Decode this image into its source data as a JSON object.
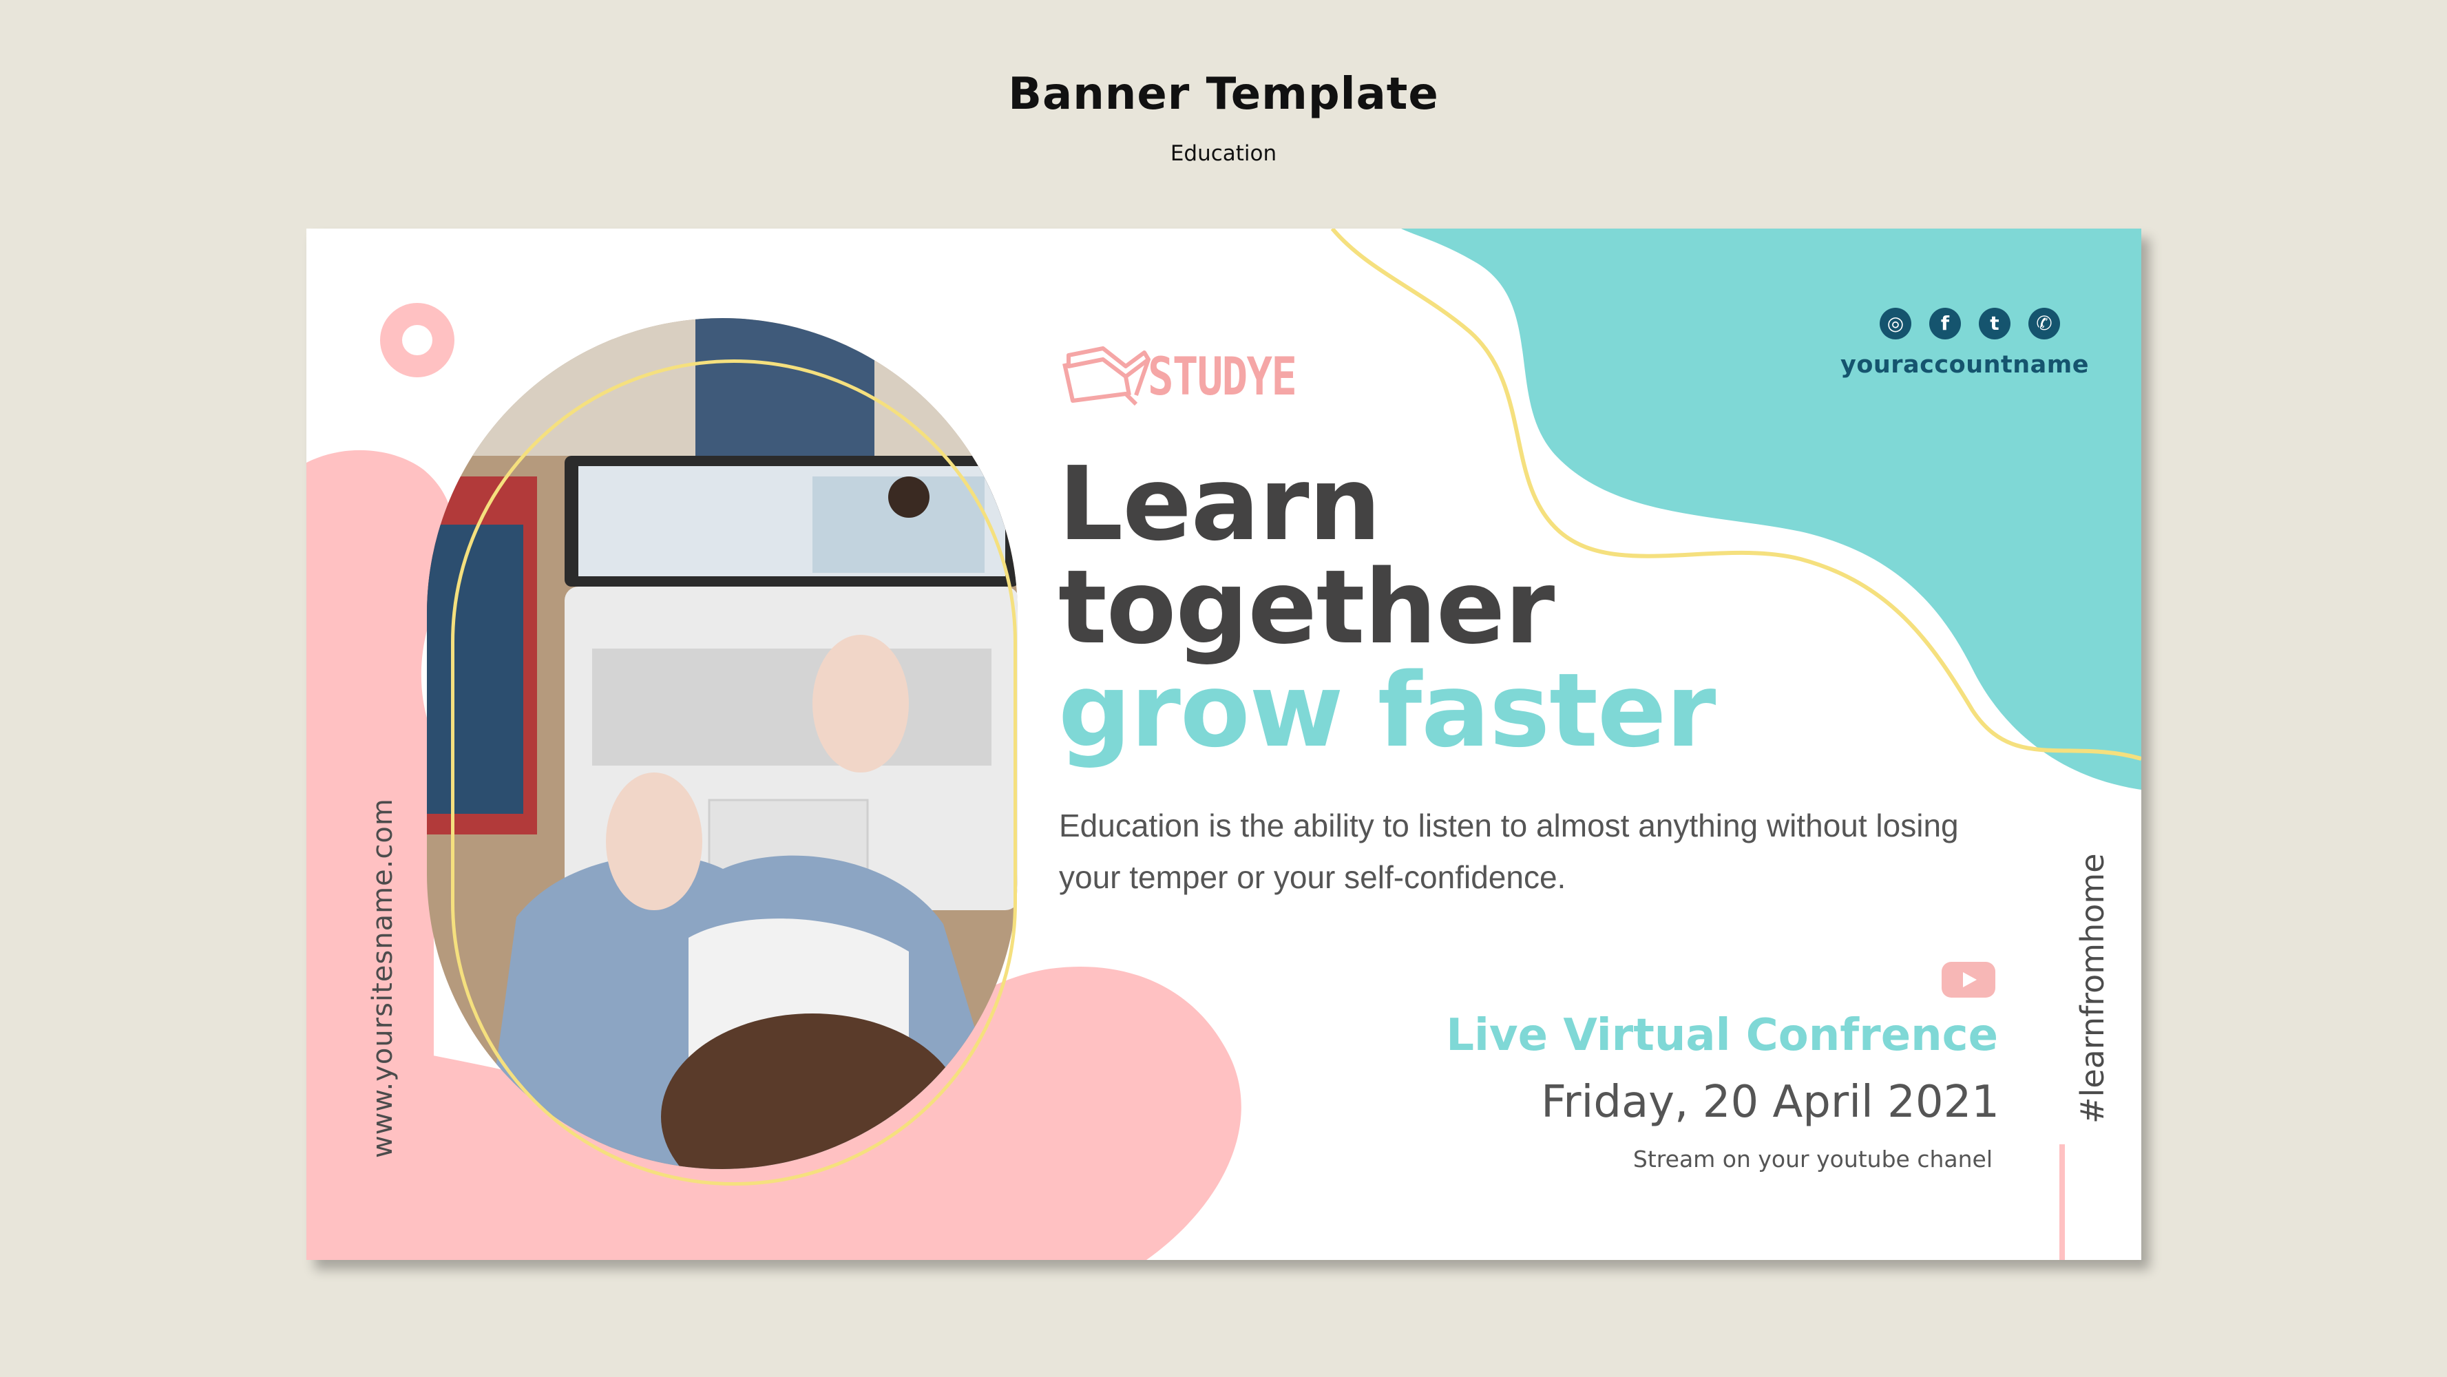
{
  "page": {
    "title": "Banner Template",
    "subtitle": "Education"
  },
  "banner": {
    "brand": "STUDYE",
    "account": "youraccountname",
    "social_icons": [
      "instagram-icon",
      "facebook-icon",
      "twitter-icon",
      "whatsapp-icon"
    ],
    "headline_line1": "Learn",
    "headline_line2": "together",
    "headline_line3": "grow faster",
    "description": "Education is the ability to listen to almost anything without losing your temper or your self-confidence.",
    "website": "www.yoursitesname.com",
    "event_title": "Live Virtual Confrence",
    "event_date": "Friday, 20 April 2021",
    "event_note": "Stream on your youtube chanel",
    "hashtag": "#learnfromhome",
    "photo_description_icon": "student-laptop-photo"
  },
  "colors": {
    "background": "#e8e5da",
    "teal": "#7fd8d6",
    "pink": "#ffc1c2",
    "yellow_line": "#f5e07e",
    "dark_text": "#444343",
    "navy": "#15546e"
  }
}
